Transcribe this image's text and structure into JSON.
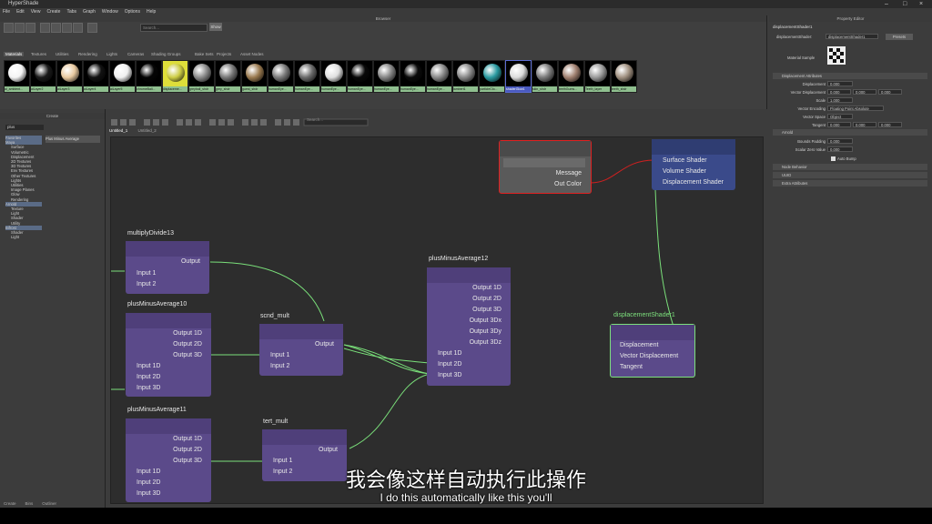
{
  "app": {
    "title": "HyperShade"
  },
  "menu": [
    "File",
    "Edit",
    "View",
    "Create",
    "Tabs",
    "Graph",
    "Window",
    "Options",
    "Help"
  ],
  "browser": {
    "title": "Browser",
    "search_placeholder": "Search...",
    "show_label": "Show",
    "tabs": [
      "Materials",
      "Textures",
      "Utilities",
      "Rendering",
      "Lights",
      "Cameras",
      "Shading Groups",
      "Bake Sets",
      "Projects",
      "Asset Nodes"
    ],
    "swatches": [
      {
        "label": "ai_ambient...",
        "ball": "#f4f4f4"
      },
      {
        "label": "aiLayer2",
        "ball": "#1a1a1a"
      },
      {
        "label": "aiLayer3",
        "ball": "#e8c9a0"
      },
      {
        "label": "aiLayer4",
        "ball": "#111111"
      },
      {
        "label": "aiLayer5",
        "ball": "#f0f0f0"
      },
      {
        "label": "chromeBall...",
        "ball": "#050505"
      },
      {
        "label": "displaceme...",
        "ball": "#cccc44"
      },
      {
        "label": "greyball_shdr",
        "ball": "#8a8a8a"
      },
      {
        "label": "grey_shdr",
        "ball": "#777777"
      },
      {
        "label": "guest_shdr",
        "ball": "#9a7a50"
      },
      {
        "label": "humanEye...",
        "ball": "#7a7a7a"
      },
      {
        "label": "humanEye...",
        "ball": "#6a6a6a"
      },
      {
        "label": "humanEye...",
        "ball": "#e0e0e0"
      },
      {
        "label": "humanEye...",
        "ball": "#080808"
      },
      {
        "label": "humanEye...",
        "ball": "#858585"
      },
      {
        "label": "humanEye...",
        "ball": "#0a0a0a"
      },
      {
        "label": "humanEye...",
        "ball": "#8a8a8a"
      },
      {
        "label": "lambert1",
        "ball": "#888888"
      },
      {
        "label": "particleClo...",
        "ball": "#2a9aa0"
      },
      {
        "label": "shaderGlow1",
        "ball": "#dcdcdc"
      },
      {
        "label": "skin_shdr",
        "ball": "#7a7a7a"
      },
      {
        "label": "teethGums...",
        "ball": "#a08070"
      },
      {
        "label": "Teeth_layer",
        "ball": "#9a9a9a"
      },
      {
        "label": "teeth_shdr",
        "ball": "#a09080"
      }
    ]
  },
  "create": {
    "title": "Create",
    "search": "plus",
    "result": "Plus Minus Average",
    "tree": [
      "Favorites",
      "Maya",
      "Surface",
      "Volumetric",
      "Displacement",
      "2D Textures",
      "3D Textures",
      "Env Textures",
      "Other Textures",
      "Lights",
      "Utilities",
      "Image Planes",
      "Glow",
      "Rendering",
      "Arnold",
      "Texture",
      "Light",
      "Shader",
      "Utility",
      "Bifrost",
      "Shader",
      "Light"
    ],
    "bottom_tabs": [
      "Create",
      "Bins",
      "Outliner"
    ]
  },
  "graph": {
    "tabs": [
      "Untitled_1",
      "Untitled_2"
    ],
    "search_placeholder": "Search...",
    "nodes": {
      "unknown": {
        "ports": [
          "Message",
          "Out Color"
        ]
      },
      "shading_group": {
        "ports": [
          "Surface Shader",
          "Volume Shader",
          "Displacement Shader"
        ]
      },
      "multiplyDivide13": {
        "title": "multiplyDivide13",
        "ports": [
          "Output",
          "Input 1",
          "Input 2"
        ]
      },
      "plusMinusAverage10": {
        "title": "plusMinusAverage10",
        "ports": [
          "Output 1D",
          "Output 2D",
          "Output 3D",
          "Input 1D",
          "Input 2D",
          "Input 3D"
        ]
      },
      "plusMinusAverage11": {
        "title": "plusMinusAverage11",
        "ports": [
          "Output 1D",
          "Output 2D",
          "Output 3D",
          "Input 1D",
          "Input 2D",
          "Input 3D"
        ]
      },
      "scnd_mult": {
        "title": "scnd_mult",
        "ports": [
          "Output",
          "Input 1",
          "Input 2"
        ]
      },
      "tert_mult": {
        "title": "tert_mult",
        "ports": [
          "Output",
          "Input 1",
          "Input 2"
        ]
      },
      "plusMinusAverage12": {
        "title": "plusMinusAverage12",
        "ports": [
          "Output 1D",
          "Output 2D",
          "Output 3D",
          "Output 3Dx",
          "Output 3Dy",
          "Output 3Dz",
          "Input 1D",
          "Input 2D",
          "Input 3D"
        ]
      },
      "displacementShader1": {
        "title": "displacementShader1",
        "ports": [
          "Displacement",
          "Vector Displacement",
          "Tangent"
        ]
      }
    }
  },
  "property_editor": {
    "title": "Property Editor",
    "tab": "displacementShader1",
    "type_label": "displacementShader:",
    "node_name": "displacementShader1",
    "presets": "Presets",
    "sample_label": "Material Sample",
    "sections": [
      "Displacement Attributes",
      "Arnold",
      "Node Behavior",
      "UUID",
      "Extra Attributes"
    ],
    "attrs": [
      {
        "label": "Displacement",
        "values": [
          "0.000"
        ]
      },
      {
        "label": "Vector Displacement",
        "values": [
          "0.000",
          "0.000",
          "0.000"
        ]
      },
      {
        "label": "Scale",
        "values": [
          "1.000"
        ]
      },
      {
        "label": "Vector Encoding",
        "values": [
          "Floating Point Absolute"
        ]
      },
      {
        "label": "Vector Space",
        "values": [
          "Object"
        ]
      },
      {
        "label": "Tangent",
        "values": [
          "0.000",
          "0.000",
          "0.000"
        ]
      }
    ],
    "arnold_attrs": [
      {
        "label": "Bounds Padding",
        "values": [
          "0.000"
        ]
      },
      {
        "label": "Scalar Zero Value",
        "values": [
          "0.000"
        ]
      }
    ],
    "auto_bump": "Auto Bump"
  },
  "subtitles": {
    "zh": "我会像这样自动执行此操作",
    "en": "I do this automatically like this you'll"
  },
  "colors": {
    "node_purple": "#5b4a8a",
    "node_blue": "#3a4a8a",
    "selected_green": "#7de07d",
    "selected_red": "#e02020",
    "connection": "#7ae07a",
    "connection_red": "#d02020"
  }
}
